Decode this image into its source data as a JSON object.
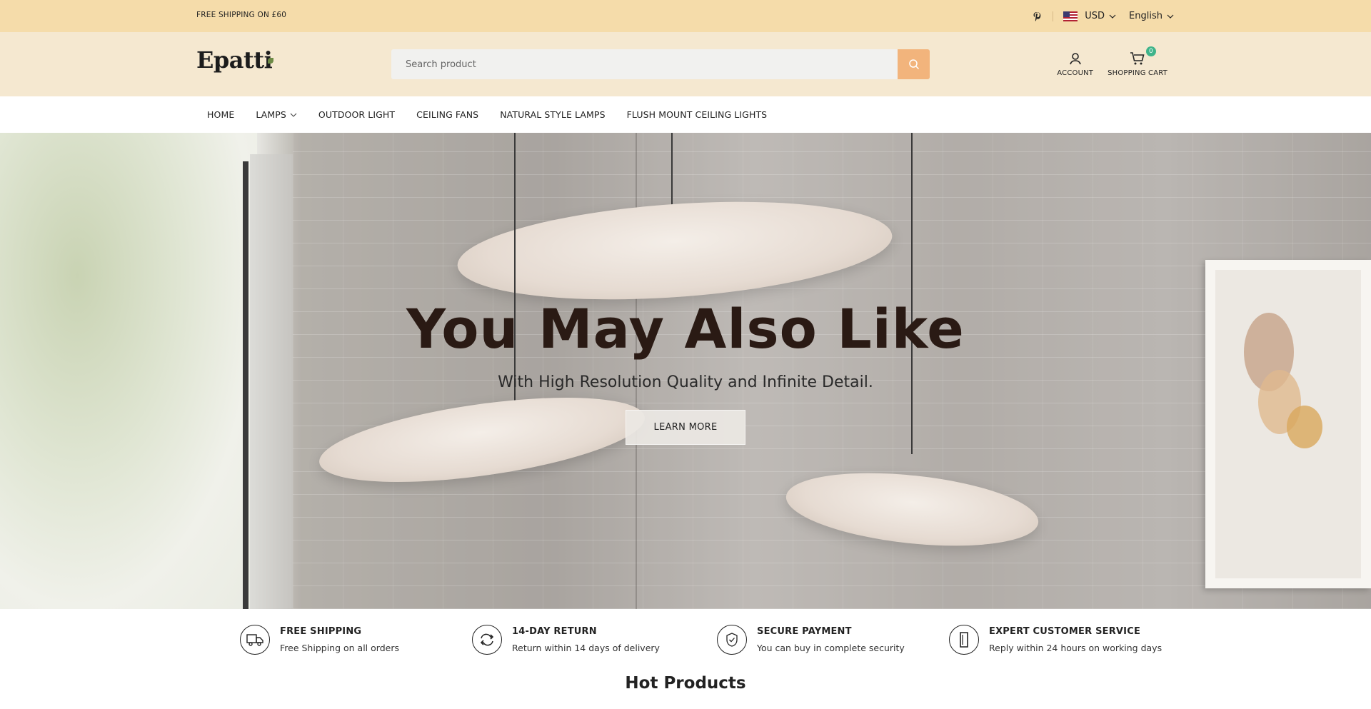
{
  "topbar": {
    "shipping": "FREE SHIPPING ON £60",
    "currency": "USD",
    "language": "English"
  },
  "header": {
    "logo": "Epatti",
    "search_placeholder": "Search product",
    "account_label": "ACCOUNT",
    "cart_label": "SHOPPING CART",
    "cart_count": "0"
  },
  "nav": {
    "items": [
      {
        "label": "HOME"
      },
      {
        "label": "LAMPS"
      },
      {
        "label": "OUTDOOR LIGHT"
      },
      {
        "label": "CEILING FANS"
      },
      {
        "label": "NATURAL STYLE LAMPS"
      },
      {
        "label": "FLUSH MOUNT CEILING LIGHTS"
      }
    ]
  },
  "hero": {
    "title": "You May Also Like",
    "subtitle": "With High Resolution Quality and Infinite Detail.",
    "button": "LEARN MORE"
  },
  "features": [
    {
      "title": "FREE SHIPPING",
      "desc": "Free Shipping on all orders",
      "icon": "truck-icon"
    },
    {
      "title": "14-DAY RETURN",
      "desc": "Return within 14 days of delivery",
      "icon": "return-icon"
    },
    {
      "title": "SECURE PAYMENT",
      "desc": "You can buy in complete security",
      "icon": "shield-icon"
    },
    {
      "title": "EXPERT CUSTOMER SERVICE",
      "desc": "Reply within 24 hours on working days",
      "icon": "headset-icon"
    }
  ],
  "section": {
    "hot_products": "Hot Products"
  },
  "colors": {
    "topbar_bg": "#f5dcaa",
    "header_bg": "#f5e8d0",
    "search_button": "#f2b47c",
    "badge": "#3fb48a"
  }
}
